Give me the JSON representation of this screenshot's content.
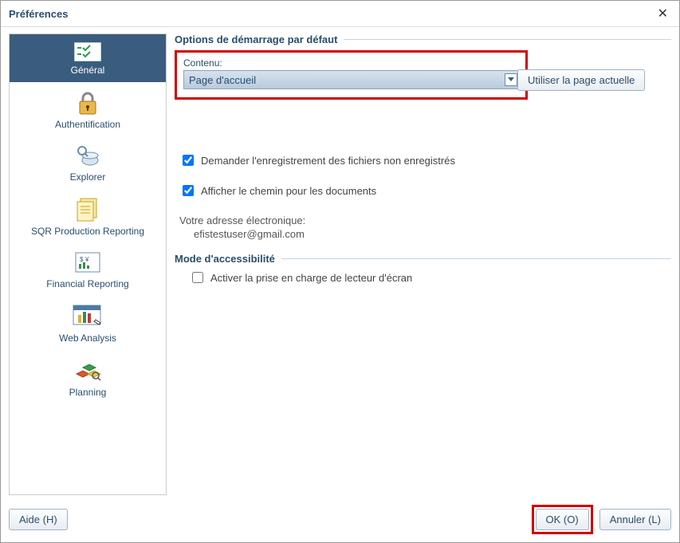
{
  "title": "Préférences",
  "sidebar": {
    "items": [
      {
        "label": "Général"
      },
      {
        "label": "Authentification"
      },
      {
        "label": "Explorer"
      },
      {
        "label": "SQR Production Reporting"
      },
      {
        "label": "Financial Reporting"
      },
      {
        "label": "Web Analysis"
      },
      {
        "label": "Planning"
      }
    ]
  },
  "startup": {
    "legend": "Options de démarrage par défaut",
    "content_label": "Contenu:",
    "content_value": "Page d'accueil",
    "use_current_label": "Utiliser la page actuelle"
  },
  "checkboxes": {
    "prompt_save": "Demander l'enregistrement des fichiers non enregistrés",
    "show_path": "Afficher le chemin pour les documents"
  },
  "email": {
    "label": "Votre adresse électronique:",
    "value": "efistestuser@gmail.com"
  },
  "accessibility": {
    "legend": "Mode d'accessibilité",
    "screen_reader": "Activer la prise en charge de lecteur d'écran"
  },
  "footer": {
    "help": "Aide (H)",
    "ok": "OK (O)",
    "cancel": "Annuler (L)"
  }
}
